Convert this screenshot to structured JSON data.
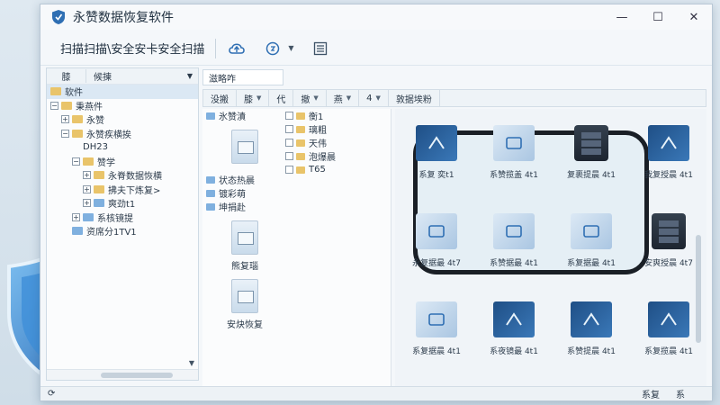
{
  "window": {
    "title": "永赞数据恢复软件"
  },
  "toolbar": {
    "title": "扫描扫描\\安全安卡安全扫描"
  },
  "left_pane": {
    "col1": "膝",
    "col2": "候揀",
    "tree": [
      {
        "label": "软件",
        "indent": 0,
        "toggle": "",
        "folder": "y",
        "sel": true
      },
      {
        "label": "秉燕件",
        "indent": 0,
        "toggle": "−",
        "folder": "y"
      },
      {
        "label": "永赞",
        "indent": 1,
        "toggle": "+",
        "folder": "y"
      },
      {
        "label": "永赞疾横挨",
        "indent": 1,
        "toggle": "−",
        "folder": "y"
      },
      {
        "label": "DH23",
        "indent": 3,
        "toggle": "",
        "folder": ""
      },
      {
        "label": "赞学",
        "indent": 2,
        "toggle": "−",
        "folder": "y"
      },
      {
        "label": "永脊数据恢横",
        "indent": 3,
        "toggle": "+",
        "folder": "y"
      },
      {
        "label": "拂夫下炼复>",
        "indent": 3,
        "toggle": "+",
        "folder": "y"
      },
      {
        "label": "爽劲t1",
        "indent": 3,
        "toggle": "+",
        "folder": "b"
      },
      {
        "label": "系核镜提",
        "indent": 2,
        "toggle": "+",
        "folder": "b"
      },
      {
        "label": "资席分1TV1",
        "indent": 2,
        "toggle": "",
        "folder": "b"
      }
    ]
  },
  "path": "滋略咋",
  "columns": [
    {
      "label": "没搬",
      "caret": false
    },
    {
      "label": "膝",
      "caret": true
    },
    {
      "label": "代",
      "caret": false
    },
    {
      "label": "撤",
      "caret": true
    },
    {
      "label": "燕",
      "caret": true
    },
    {
      "label": "4",
      "caret": true
    },
    {
      "label": "敦据埃粉",
      "caret": false
    }
  ],
  "middle": {
    "list_top": "氷赞漬",
    "sub_list": [
      "衡1",
      "璃粗",
      "天伟",
      "泡爆晨",
      "T65"
    ],
    "files": [
      "状态热晨",
      "镀彩萌",
      "坤捐赴"
    ],
    "doc_labels": [
      "熊复瑙",
      "安炔恢复"
    ]
  },
  "thumbs": [
    {
      "label": "系复 奕t1",
      "kind": "dark"
    },
    {
      "label": "系赞揽盖 4t1",
      "kind": "light"
    },
    {
      "label": "复裹提晨 4t1",
      "kind": "server"
    },
    {
      "label": "我复授晨 4t1",
      "kind": "dark"
    },
    {
      "label": "永复据最 4t7",
      "kind": "light"
    },
    {
      "label": "系赞据最 4t1",
      "kind": "light"
    },
    {
      "label": "系复据最 4t1",
      "kind": "light"
    },
    {
      "label": "安爽授晨 4t7",
      "kind": "server"
    },
    {
      "label": "系复据晨 4t1",
      "kind": "light"
    },
    {
      "label": "系夜镜最 4t1",
      "kind": "dark"
    },
    {
      "label": "系赞提晨 4t1",
      "kind": "dark"
    },
    {
      "label": "系复揽晨 4t1",
      "kind": "dark"
    }
  ],
  "status": {
    "left": "⟳",
    "right1": "系复",
    "right2": "系"
  },
  "colors": {
    "accent": "#2f6fb3",
    "shield": "#3b87d6"
  }
}
